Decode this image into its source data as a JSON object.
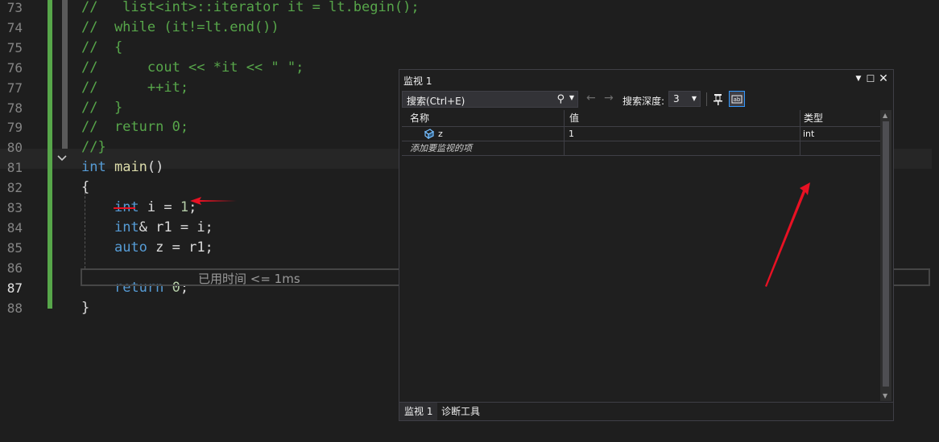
{
  "editor": {
    "lines": [
      {
        "num": "73",
        "parts": [
          {
            "c": "cm",
            "t": "//   list<int>::iterator it = lt.begin();"
          }
        ]
      },
      {
        "num": "74",
        "parts": [
          {
            "c": "cm",
            "t": "//  while (it!=lt.end())"
          }
        ]
      },
      {
        "num": "75",
        "parts": [
          {
            "c": "cm",
            "t": "//  {"
          }
        ]
      },
      {
        "num": "76",
        "parts": [
          {
            "c": "cm",
            "t": "//      cout << *it << \" \";"
          }
        ]
      },
      {
        "num": "77",
        "parts": [
          {
            "c": "cm",
            "t": "//      ++it;"
          }
        ]
      },
      {
        "num": "78",
        "parts": [
          {
            "c": "cm",
            "t": "//  }"
          }
        ]
      },
      {
        "num": "79",
        "parts": [
          {
            "c": "cm",
            "t": "//  return 0;"
          }
        ]
      },
      {
        "num": "80",
        "parts": [
          {
            "c": "cm",
            "t": "//}"
          }
        ]
      },
      {
        "num": "81",
        "parts": [
          {
            "c": "kw",
            "t": "int"
          },
          {
            "c": "tx",
            "t": " "
          },
          {
            "c": "fn",
            "t": "main"
          },
          {
            "c": "tx",
            "t": "()"
          }
        ]
      },
      {
        "num": "82",
        "parts": [
          {
            "c": "tx",
            "t": "{"
          }
        ]
      },
      {
        "num": "83",
        "parts": [
          {
            "c": "tx",
            "t": "    "
          },
          {
            "c": "kw",
            "t": "int"
          },
          {
            "c": "tx",
            "t": " i = "
          },
          {
            "c": "nm",
            "t": "1"
          },
          {
            "c": "tx",
            "t": ";"
          }
        ]
      },
      {
        "num": "84",
        "parts": [
          {
            "c": "tx",
            "t": "    "
          },
          {
            "c": "kw",
            "t": "int"
          },
          {
            "c": "tx",
            "t": "& r1 = i;"
          }
        ]
      },
      {
        "num": "85",
        "parts": [
          {
            "c": "tx",
            "t": "    "
          },
          {
            "c": "kw",
            "t": "auto"
          },
          {
            "c": "tx",
            "t": " z = r1;"
          }
        ]
      },
      {
        "num": "86",
        "parts": []
      },
      {
        "num": "87",
        "parts": [
          {
            "c": "tx",
            "t": "    "
          },
          {
            "c": "kw",
            "t": "return"
          },
          {
            "c": "tx",
            "t": " "
          },
          {
            "c": "nm",
            "t": "0"
          },
          {
            "c": "tx",
            "t": ";"
          }
        ]
      },
      {
        "num": "88",
        "parts": [
          {
            "c": "tx",
            "t": "}"
          }
        ]
      }
    ],
    "perf_tip": "已用时间 <= 1ms"
  },
  "watch": {
    "title": "监视 1",
    "search_placeholder": "搜索(Ctrl+E)",
    "depth_label": "搜索深度:",
    "depth_value": "3",
    "columns": {
      "name": "名称",
      "value": "值",
      "type": "类型"
    },
    "rows": [
      {
        "name": "z",
        "value": "1",
        "type": "int"
      }
    ],
    "add_item": "添加要监视的项",
    "tabs": [
      "监视 1",
      "诊断工具"
    ]
  },
  "colors": {
    "comment": "#57a64a",
    "keyword": "#569cd6",
    "annotation": "#e81123"
  }
}
